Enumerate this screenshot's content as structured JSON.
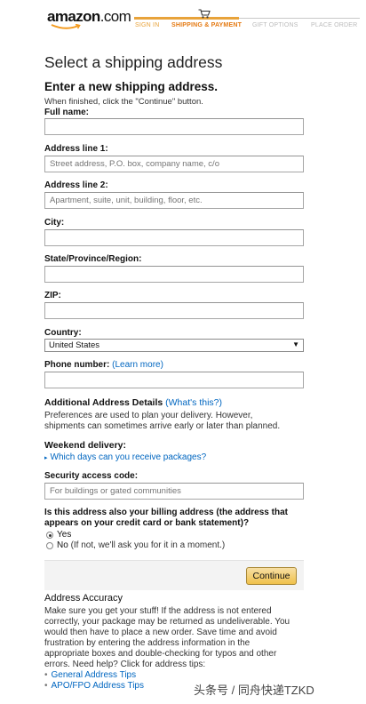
{
  "header": {
    "logo_main": "amazon",
    "logo_suffix": ".com",
    "steps": [
      {
        "label": "SIGN IN",
        "state": "done"
      },
      {
        "label": "SHIPPING & PAYMENT",
        "state": "current"
      },
      {
        "label": "GIFT OPTIONS",
        "state": "todo"
      },
      {
        "label": "PLACE ORDER",
        "state": "todo"
      }
    ],
    "progress_fraction": 0.47,
    "accent_color": "#e47911",
    "cart_icon": "cart-icon"
  },
  "page_title": "Select a shipping address",
  "form": {
    "title": "Enter a new shipping address.",
    "instructions": "When finished, click the \"Continue\" button.",
    "full_name": {
      "label": "Full name:",
      "value": "",
      "placeholder": ""
    },
    "address1": {
      "label": "Address line 1:",
      "value": "",
      "placeholder": "Street address, P.O. box, company name, c/o"
    },
    "address2": {
      "label": "Address line 2:",
      "value": "",
      "placeholder": "Apartment, suite, unit, building, floor, etc."
    },
    "city": {
      "label": "City:",
      "value": "",
      "placeholder": ""
    },
    "state": {
      "label": "State/Province/Region:",
      "value": "",
      "placeholder": ""
    },
    "zip": {
      "label": "ZIP:",
      "value": "",
      "placeholder": ""
    },
    "country": {
      "label": "Country:",
      "selected": "United States"
    },
    "phone": {
      "label": "Phone number:",
      "link": "(Learn more)",
      "value": "",
      "placeholder": ""
    }
  },
  "additional": {
    "heading": "Additional Address Details",
    "link": "(What's this?)",
    "description": [
      "Preferences are used to plan your delivery. However,",
      "shipments can sometimes arrive early or later than planned."
    ],
    "weekend_heading": "Weekend delivery:",
    "weekend_link": "Which days can you receive packages?",
    "security_label": "Security access code:",
    "security_placeholder": "For buildings or gated communities"
  },
  "billing": {
    "question": [
      "Is this address also your billing address (the address that",
      "appears on your credit card or bank statement)?"
    ],
    "yes_label": "Yes",
    "no_label": "No",
    "no_hint": "(If not, we'll ask you for it in a moment.)",
    "selected": "yes"
  },
  "continue_label": "Continue",
  "accuracy": {
    "heading": "Address Accuracy",
    "lines": [
      "Make sure you get your stuff! If the address is not entered",
      "correctly, your package may be returned as undeliverable. You",
      "would then have to place a new order. Save time and avoid",
      "frustration by entering the address information in the",
      "appropriate boxes and double-checking for typos and other",
      "errors. Need help? Click for address tips:"
    ],
    "tips": [
      "General Address Tips",
      "APO/FPO Address Tips"
    ]
  },
  "watermark": "头条号 / 同舟快递TZKD"
}
